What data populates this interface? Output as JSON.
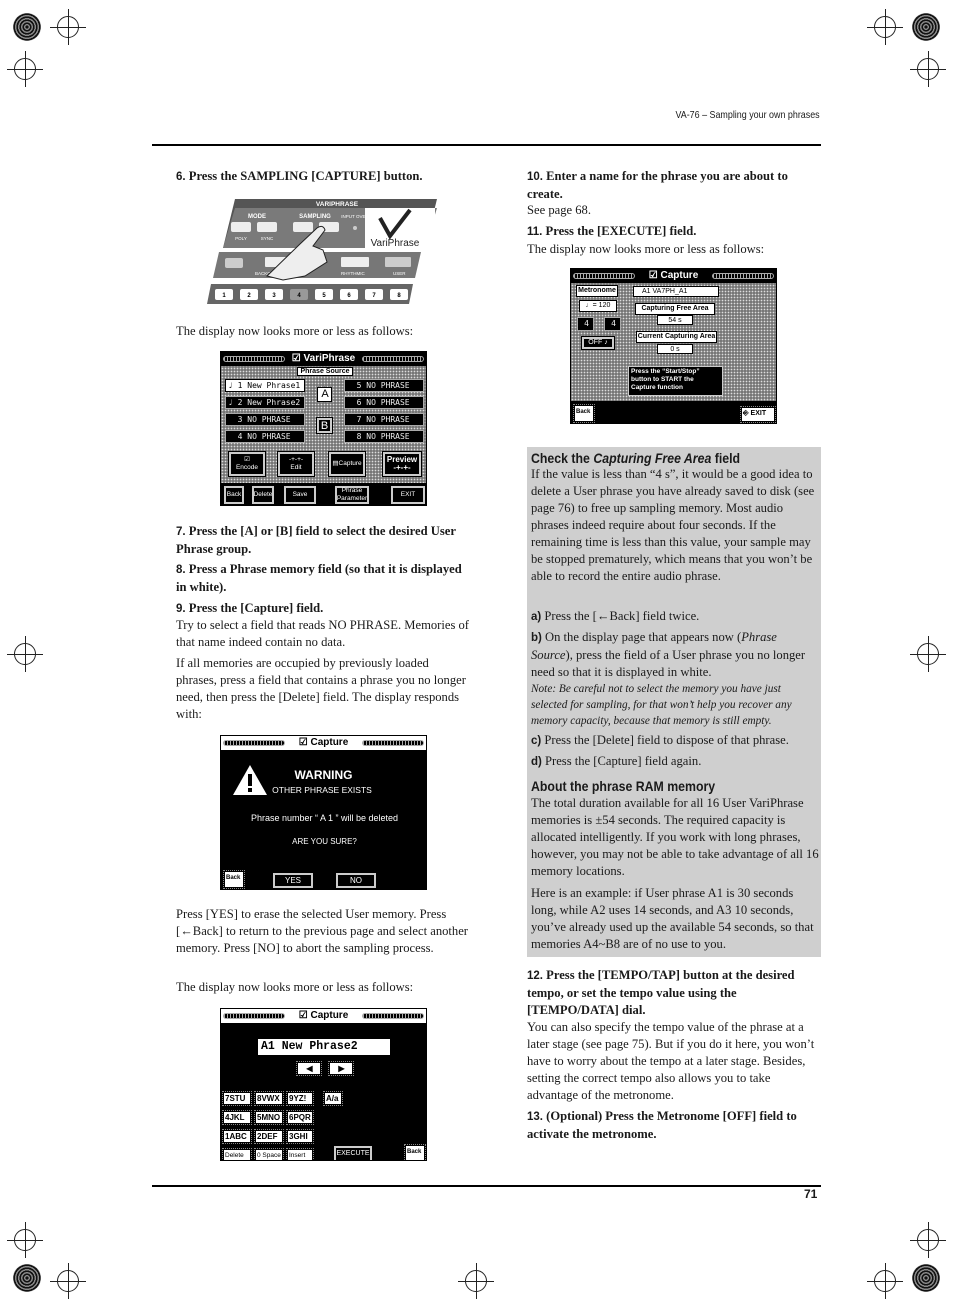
{
  "header": {
    "running_title": "VA-76 – Sampling your own phrases",
    "page_number": "71"
  },
  "left": {
    "step6": {
      "num": "6.",
      "text": "Press the SAMPLING [CAPTURE] button."
    },
    "panel": {
      "title": "VARIPHRASE",
      "mode": "MODE",
      "sampling": "SAMPLING",
      "input_over": "INPUT OVER",
      "poly": "POLY",
      "sync": "SYNC",
      "logo": "VariPhrase",
      "backgr": "BACKGROUND",
      "rhythmic": "RHYTHMIC",
      "user": "USER",
      "numbers": [
        "1",
        "2",
        "3",
        "4",
        "5",
        "6",
        "7",
        "8"
      ]
    },
    "display_note1": "The display now looks more or less as follows:",
    "step7": {
      "num": "7.",
      "text": "Press the [A] or [B] field to select the desired User Phrase group."
    },
    "step8": {
      "num": "8.",
      "text": "Press a Phrase memory field (so that it is displayed in white)."
    },
    "step9": {
      "num": "9.",
      "text": "Press the [Capture] field."
    },
    "p9a": "Try to select a field that reads NO PHRASE. Memories of that name indeed contain no data.",
    "p9b": "If all memories are occupied by previously loaded phrases, press a field that contains a phrase you no longer need, then press the [Delete] field. The display responds with:",
    "p_yes": "Press [YES] to erase the selected User memory. Press [←Back] to return to the previous page and select another memory. Press [NO] to abort the sampling process.",
    "display_note2": "The display now looks more or less as follows:"
  },
  "screen_variphrase": {
    "title": "VariPhrase",
    "section": "Phrase Source",
    "phrases": [
      "♩ 1 New Phrase1",
      "♩ 2 New Phrase2",
      "  3 NO PHRASE",
      "  4 NO PHRASE",
      "  5 NO PHRASE",
      "  6 NO PHRASE",
      "  7 NO PHRASE",
      "  8 NO PHRASE"
    ],
    "group_a": "A",
    "group_b": "B",
    "buttons": [
      "Encode",
      "Edit",
      "Capture",
      "Preview"
    ],
    "bottom": [
      "Back",
      "Delete",
      "Save",
      "Phrase Parameter",
      "EXIT"
    ]
  },
  "screen_warning": {
    "title": "Capture",
    "heading": "WARNING",
    "sub": "OTHER PHRASE EXISTS",
    "message": "Phrase number “ A 1 ” will be deleted",
    "question": "ARE YOU SURE?",
    "back": "Back",
    "yes": "YES",
    "no": "NO"
  },
  "screen_name": {
    "title": "Capture",
    "name_prefix": "A1",
    "name": "New Phrase2",
    "keys": [
      "7STU",
      "8VWX",
      "9YZ!",
      "A/a",
      "4JKL",
      "5MNO",
      "6PQR",
      "1ABC",
      "2DEF",
      "3GHI",
      "Delete",
      "0 Space",
      "Insert"
    ],
    "execute": "EXECUTE",
    "back": "Back"
  },
  "right": {
    "step10": {
      "num": "10.",
      "text": "Enter a name for the phrase you are about to create."
    },
    "see_page": "See page 68.",
    "step11": {
      "num": "11.",
      "text": "Press the [EXECUTE] field."
    },
    "display_note": "The display now looks more or less as follows:",
    "box": {
      "heading1_pre": "Check the ",
      "heading1_it": "Capturing Free Area",
      "heading1_post": " field",
      "p1": "If the value is less than “4 s”, it would be a good idea to delete a User phrase you have already saved to disk (see page 76) to free up sampling memory. Most audio phrases indeed require about four seconds. If the remaining time is less than this value, your sample may be stopped prematurely, which means that you won’t be able to record the entire audio phrase.",
      "a_label": "a)",
      "a": "Press the [←Back] field twice.",
      "b_label": "b)",
      "b_pre": "On the display page that appears now (",
      "b_it": "Phrase Source",
      "b_post": "), press the field of a User phrase you no longer need so that it is displayed in white.",
      "note": "Note: Be careful not to select the memory you have just selected for sampling, for that won’t help you recover any memory capacity, because that memory is still empty.",
      "c_label": "c)",
      "c": "Press the [Delete] field to dispose of that phrase.",
      "d_label": "d)",
      "d": "Press the [Capture] field again.",
      "heading2": "About the phrase RAM memory",
      "p2": "The total duration available for all 16 User VariPhrase memories is ±54 seconds. The required capacity is allocated intelligently. If you work with long phrases, however, you may not be able to take advantage of all 16 memory locations.",
      "p3": "Here is an example: if User phrase A1 is 30 seconds long, while A2 uses 14 seconds, and A3 10 seconds, you’ve already used up the available 54 seconds, so that memories A4~B8 are of no use to you."
    },
    "step12": {
      "num": "12.",
      "text": "Press the [TEMPO/TAP] button at the desired tempo, or set the tempo value using the [TEMPO/DATA] dial."
    },
    "p12": "You can also specify the tempo value of the phrase at a later stage (see page 75). But if you do it here, you won’t have to worry about the tempo at a later stage. Besides, setting the correct tempo also allows you to take advantage of the metronome.",
    "step13": {
      "num": "13.",
      "text": "(Optional) Press the Metronome [OFF] field to activate the metronome."
    }
  },
  "screen_capture": {
    "title": "Capture",
    "metronome": "Metronome",
    "tempo": "♩= 120",
    "beat_num": "4",
    "beat_den": "4",
    "metro_state": "OFF",
    "phrase": "A1 VA7PH_A1",
    "free_label": "Capturing Free Area",
    "free_value": "54 s",
    "current_label": "Current Capturing Area",
    "current_value": "0 s",
    "message": "Press the “Start/Stop” button to START the Capture function",
    "back": "Back",
    "exit": "EXIT"
  }
}
